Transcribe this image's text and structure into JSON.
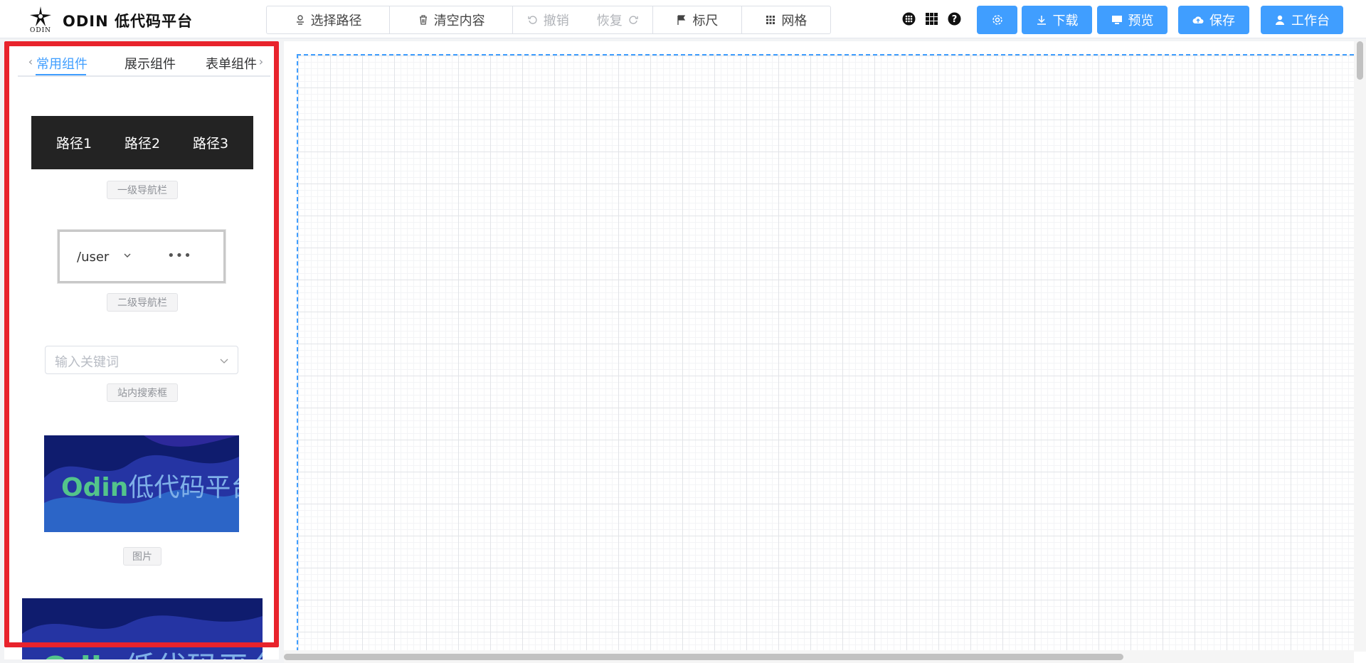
{
  "header": {
    "logo_text": "ODIN",
    "brand": "ODIN 低代码平台",
    "toolbar": {
      "select_path": "选择路径",
      "clear": "清空内容",
      "undo": "撤销",
      "redo": "恢复",
      "ruler": "标尺",
      "grid": "网格"
    },
    "actions": {
      "download": "下载",
      "preview": "预览",
      "save": "保存",
      "workbench": "工作台"
    },
    "accent_color": "#409eff"
  },
  "left_panel": {
    "tabs": [
      "常用组件",
      "展示组件",
      "表单组件"
    ],
    "active_tab": 0,
    "components": {
      "nav1": {
        "items": [
          "路径1",
          "路径2",
          "路径3"
        ],
        "label": "一级导航栏"
      },
      "nav2": {
        "path": "/user",
        "more": "•••",
        "label": "二级导航栏"
      },
      "search": {
        "placeholder": "输入关键词",
        "label": "站内搜索框"
      },
      "image": {
        "brand_en": "Odin",
        "brand_cn": "低代码平台",
        "label": "图片"
      }
    },
    "highlight_color": "#e8232c"
  }
}
